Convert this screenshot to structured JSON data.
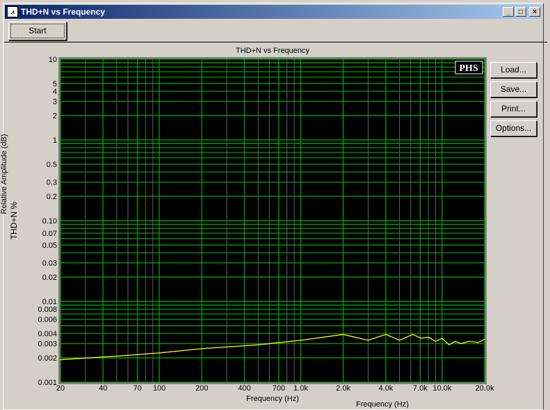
{
  "window": {
    "title": "THD+N vs Frequency",
    "minimize": "_",
    "maximize": "□",
    "close": "×"
  },
  "toolbar": {
    "start_label": "Start"
  },
  "side_buttons": {
    "load": "Load...",
    "save": "Save...",
    "print": "Print...",
    "options": "Options..."
  },
  "background": {
    "ylabel": "Relative Amplitude (dB)",
    "xlabel": "Frequency (Hz)"
  },
  "colors": {
    "plot_bg": "#000000",
    "grid": "#00a000",
    "minor_grid": "#606060",
    "trace": "#ffff00"
  },
  "chart_data": {
    "type": "line",
    "title": "THD+N vs Frequency",
    "xlabel": "Frequency (Hz)",
    "ylabel": "THD+N %",
    "xscale": "log",
    "yscale": "log",
    "xlim": [
      20,
      20000
    ],
    "ylim": [
      0.001,
      10
    ],
    "grid": true,
    "watermark": "PHS",
    "xticks": [
      [
        20,
        "20"
      ],
      [
        40,
        "40"
      ],
      [
        70,
        "70"
      ],
      [
        100,
        "100"
      ],
      [
        200,
        "200"
      ],
      [
        400,
        "400"
      ],
      [
        700,
        "700"
      ],
      [
        1000,
        "1.0k"
      ],
      [
        2000,
        "2.0k"
      ],
      [
        4000,
        "4.0k"
      ],
      [
        7000,
        "7.0k"
      ],
      [
        10000,
        "10.0k"
      ],
      [
        20000,
        "20.0k"
      ]
    ],
    "yticks": [
      [
        10,
        "10"
      ],
      [
        5,
        "5"
      ],
      [
        4,
        "4"
      ],
      [
        3,
        "3"
      ],
      [
        2,
        "2"
      ],
      [
        1,
        "1"
      ],
      [
        0.5,
        "0.5"
      ],
      [
        0.3,
        "0.3"
      ],
      [
        0.2,
        "0.2"
      ],
      [
        0.1,
        "0.10"
      ],
      [
        0.07,
        "0.07"
      ],
      [
        0.05,
        "0.05"
      ],
      [
        0.03,
        "0.03"
      ],
      [
        0.02,
        "0.02"
      ],
      [
        0.01,
        "0.01"
      ],
      [
        0.008,
        "0.008"
      ],
      [
        0.006,
        "0.006"
      ],
      [
        0.004,
        "0.004"
      ],
      [
        0.003,
        "0.003"
      ],
      [
        0.002,
        "0.002"
      ],
      [
        0.001,
        "0.001"
      ]
    ],
    "series": [
      {
        "x": [
          20,
          50,
          100,
          200,
          500,
          1000,
          2000,
          3000,
          4000,
          5000,
          6200,
          7100,
          8000,
          9000,
          10000,
          11200,
          12400,
          13600,
          15500,
          18000,
          20000
        ],
        "y": [
          0.0019,
          0.0021,
          0.0023,
          0.0026,
          0.0029,
          0.0033,
          0.0039,
          0.0033,
          0.0039,
          0.0033,
          0.0039,
          0.0035,
          0.0036,
          0.0032,
          0.0035,
          0.0029,
          0.0032,
          0.003,
          0.0032,
          0.0031,
          0.0034
        ]
      }
    ]
  }
}
